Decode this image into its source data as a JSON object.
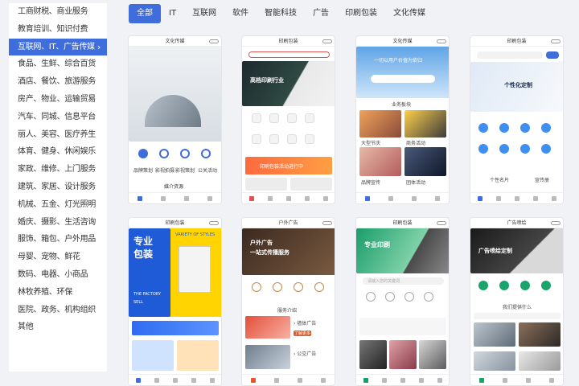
{
  "sidebar": {
    "items": [
      {
        "label": "工商财税、商业服务"
      },
      {
        "label": "教育培训、知识付费"
      },
      {
        "label": "互联网、IT、广告传媒",
        "active": true
      },
      {
        "label": "食品、生鲜、综合百货"
      },
      {
        "label": "酒店、餐饮、旅游服务"
      },
      {
        "label": "房产、物业、运输贸易"
      },
      {
        "label": "汽车、同城、信息平台"
      },
      {
        "label": "丽人、美容、医疗养生"
      },
      {
        "label": "体育、健身、休闲娱乐"
      },
      {
        "label": "家政、维修、上门服务"
      },
      {
        "label": "建筑、家居、设计服务"
      },
      {
        "label": "机械、五金、灯光照明"
      },
      {
        "label": "婚庆、摄影、生活咨询"
      },
      {
        "label": "服饰、箱包、户外用品"
      },
      {
        "label": "母婴、宠物、鲜花"
      },
      {
        "label": "数码、电器、小商品"
      },
      {
        "label": "林牧养殖、环保"
      },
      {
        "label": "医院、政务、机构组织"
      },
      {
        "label": "其他"
      }
    ],
    "active_chevron": "›"
  },
  "tabs": [
    {
      "label": "全部",
      "active": true
    },
    {
      "label": "IT"
    },
    {
      "label": "互联网"
    },
    {
      "label": "软件"
    },
    {
      "label": "智能科技"
    },
    {
      "label": "广告"
    },
    {
      "label": "印刷包装"
    },
    {
      "label": "文化传媒"
    }
  ],
  "cards": [
    {
      "title": "文化传媒",
      "texts": [
        "品牌策划",
        "影视拍摄",
        "影视策划",
        "公关活动",
        "媒介资源"
      ]
    },
    {
      "title": "印刷包装",
      "texts": [
        "高档印刷行业",
        "印刷包装活动进行中"
      ]
    },
    {
      "title": "文化传媒",
      "texts": [
        "一切以用户价值为依归",
        "业务板块",
        "大型节庆",
        "商务活动",
        "品牌宣传",
        "团体活动"
      ]
    },
    {
      "title": "印刷包装",
      "texts": [
        "个性化定制",
        "个性名片",
        "宣传册"
      ]
    },
    {
      "title": "印刷包装",
      "texts": [
        "专业",
        "包装",
        "VARIETY OF STYLES",
        "THE FACTORY",
        "SELL"
      ]
    },
    {
      "title": "户外广告",
      "texts": [
        "户外广告",
        "一站式传播服务",
        "服务介绍",
        "› 墙体广告",
        "› 公交广告",
        "了解更多"
      ]
    },
    {
      "title": "印刷包装",
      "texts": [
        "专业印刷",
        "请输入您的关键词"
      ]
    },
    {
      "title": "广告喷绘",
      "texts": [
        "广告喷绘定制",
        "我们提供什么"
      ]
    }
  ],
  "colors": {
    "accent": "#3f6ddc",
    "sidebar_bg": "#ffffff",
    "page_bg": "#f1f2f5"
  }
}
